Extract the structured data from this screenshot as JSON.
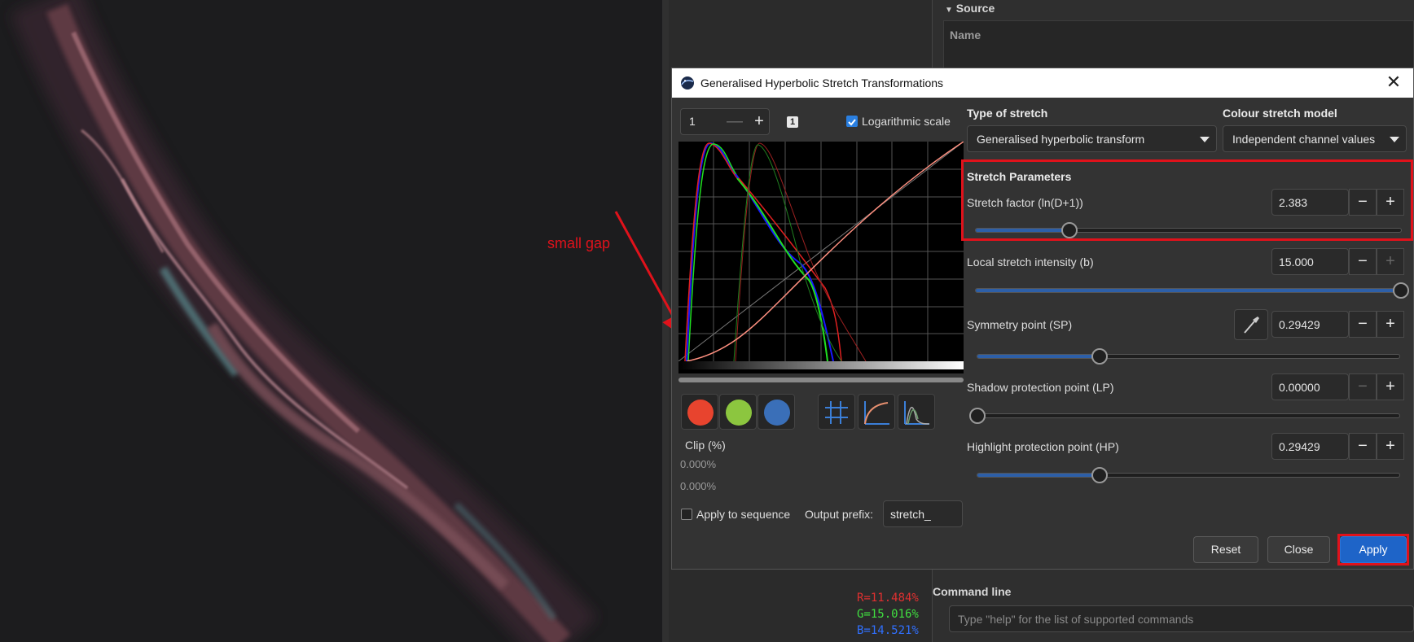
{
  "source_panel": {
    "header": "Source",
    "name_column": "Name"
  },
  "pixel_readout": {
    "r": {
      "text": "R=11.484%",
      "color": "#e03030"
    },
    "g": {
      "text": "G=15.016%",
      "color": "#40e040"
    },
    "b": {
      "text": "B=14.521%",
      "color": "#3070ff"
    }
  },
  "command_line": {
    "label": "Command line",
    "placeholder": "Type \"help\" for the list of supported commands"
  },
  "annotation": {
    "text": "small gap",
    "color": "#e0121b"
  },
  "dialog": {
    "title": "Generalised Hyperbolic Stretch Transformations",
    "close_glyph": "✕",
    "zoom": {
      "value": "1",
      "minus": "—",
      "plus": "+",
      "badge": "1"
    },
    "log_scale": {
      "label": "Logarithmic scale",
      "checked": true
    },
    "type_of_stretch": {
      "label": "Type of stretch",
      "value": "Generalised hyperbolic transform"
    },
    "colour_model": {
      "label": "Colour stretch model",
      "value": "Independent channel values"
    },
    "stretch_params_header": "Stretch Parameters",
    "params": [
      {
        "label": "Stretch factor (ln(D+1))",
        "value": "2.383",
        "level": 0.22
      },
      {
        "label": "Local stretch intensity (b)",
        "value": "15.000",
        "level": 1.0
      },
      {
        "label": "Symmetry point (SP)",
        "value": "0.29429",
        "level": 0.29
      },
      {
        "label": "Shadow protection point (LP)",
        "value": "0.00000",
        "level": 0.0
      },
      {
        "label": "Highlight protection point (HP)",
        "value": "0.29429",
        "level": 0.29
      }
    ],
    "minus": "−",
    "plus": "+",
    "channels": {
      "red": "#e8442e",
      "green": "#8cc63f",
      "blue": "#3a6fb8"
    },
    "clip": {
      "label": "Clip (%)",
      "low": "0.000%",
      "high": "0.000%"
    },
    "apply_to_sequence": {
      "label": "Apply to sequence",
      "checked": false
    },
    "output_prefix": {
      "label": "Output prefix:",
      "value": "stretch_"
    },
    "buttons": {
      "reset": "Reset",
      "close": "Close",
      "apply": "Apply"
    }
  }
}
